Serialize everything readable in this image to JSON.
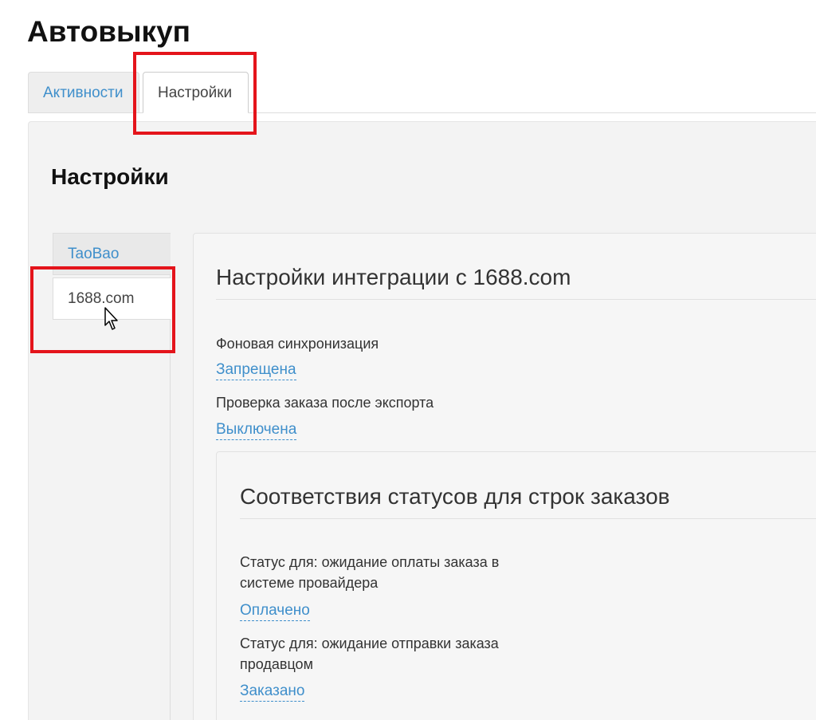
{
  "page": {
    "title": "Автовыкуп"
  },
  "tabs": [
    {
      "label": "Активности",
      "active": false
    },
    {
      "label": "Настройки",
      "active": true
    }
  ],
  "panel": {
    "title": "Настройки"
  },
  "side_nav": [
    {
      "label": "TaoBao",
      "active": false
    },
    {
      "label": "1688.com",
      "active": true
    }
  ],
  "integration": {
    "title": "Настройки интеграции с 1688.com",
    "fields": [
      {
        "label": "Фоновая синхронизация",
        "value": "Запрещена"
      },
      {
        "label": "Проверка заказа после экспорта",
        "value": "Выключена"
      }
    ]
  },
  "statuses": {
    "title": "Соответствия статусов для строк заказов",
    "fields": [
      {
        "label_line1": "Статус для: ожидание оплаты заказа в",
        "label_line2": "системе провайдера",
        "value": "Оплачено"
      },
      {
        "label_line1": "Статус для: ожидание отправки заказа",
        "label_line2": "продавцом",
        "value": "Заказано"
      }
    ]
  },
  "colors": {
    "link": "#3f8fcb",
    "highlight": "#e4141b"
  },
  "icons": {
    "cursor": "mouse-pointer-icon"
  }
}
